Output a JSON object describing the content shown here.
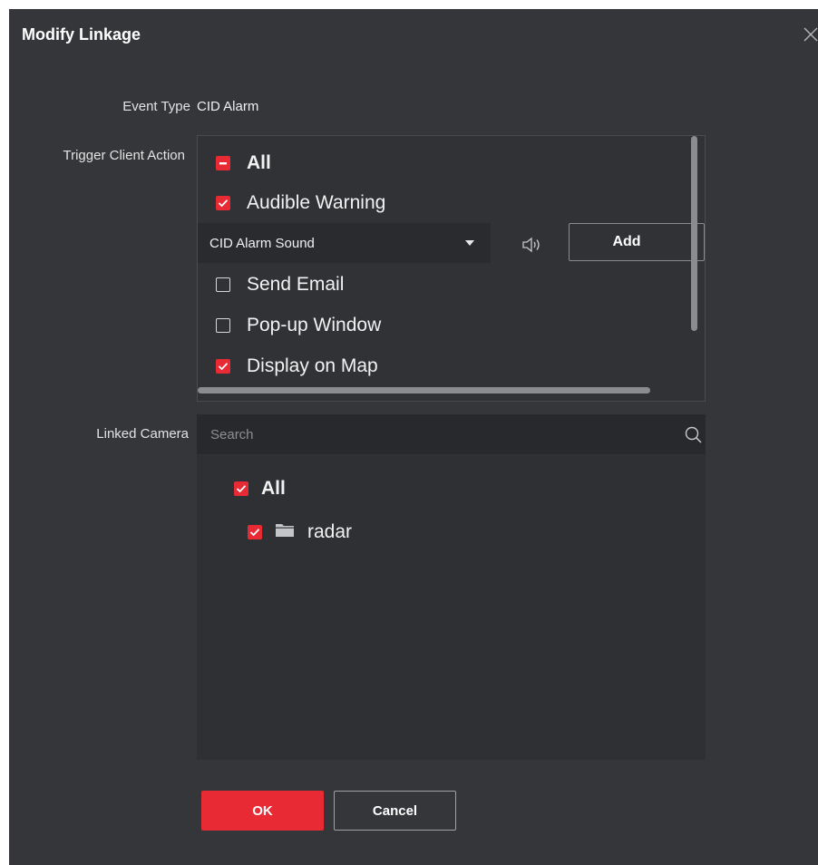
{
  "dialog": {
    "title": "Modify Linkage",
    "close_icon": "close-icon"
  },
  "event_type": {
    "label": "Event Type",
    "value": "CID Alarm"
  },
  "trigger_client_action": {
    "label": "Trigger Client Action",
    "items": [
      {
        "label": "All",
        "state": "partial"
      },
      {
        "label": "Audible Warning",
        "state": "checked"
      },
      {
        "label": "Send Email",
        "state": "unchecked"
      },
      {
        "label": "Pop-up Window",
        "state": "unchecked"
      },
      {
        "label": "Display on Map",
        "state": "checked"
      }
    ],
    "sound_select": {
      "value": "CID Alarm Sound",
      "icon": "chevron-down-icon"
    },
    "speaker_icon": "speaker-icon",
    "add_button": "Add"
  },
  "linked_camera": {
    "label": "Linked Camera",
    "search_placeholder": "Search",
    "search_icon": "search-icon",
    "tree": [
      {
        "label": "All",
        "state": "checked"
      },
      {
        "label": "radar",
        "state": "checked",
        "icon": "folder-icon"
      }
    ]
  },
  "buttons": {
    "ok": "OK",
    "cancel": "Cancel"
  },
  "colors": {
    "accent": "#e72a33",
    "dialog_bg": "#35363a",
    "field_bg": "#2a2b2f"
  }
}
